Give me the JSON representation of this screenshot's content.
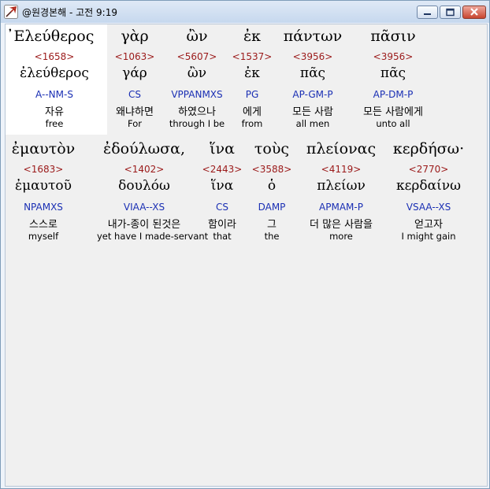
{
  "window": {
    "title": "@원경본해 - 고전 9:19",
    "icon": "cursor-arrow-icon",
    "buttons": [
      "minimize-icon",
      "maximize-icon",
      "close-icon"
    ]
  },
  "verse_lines": [
    {
      "words": [
        {
          "greek": "᾿Ελεύθερος",
          "strong": "<1658>",
          "lemma": "ἐλεύθερος",
          "parse": "A--NM-S",
          "korean": "자유",
          "english": "free",
          "highlighted": true
        },
        {
          "greek": "γὰρ",
          "strong": "<1063>",
          "lemma": "γάρ",
          "parse": "CS",
          "korean": "왜냐하면",
          "english": "For"
        },
        {
          "greek": "ὢν",
          "strong": "<5607>",
          "lemma": "ὢν",
          "parse": "VPPANMXS",
          "korean": "하였으나",
          "english": "through I be"
        },
        {
          "greek": "ἐκ",
          "strong": "<1537>",
          "lemma": "ἐκ",
          "parse": "PG",
          "korean": "에게",
          "english": "from"
        },
        {
          "greek": "πάντων",
          "strong": "<3956>",
          "lemma": "πᾶς",
          "parse": "AP-GM-P",
          "korean": "모든 사람",
          "english": "all men"
        },
        {
          "greek": "πᾶσιν",
          "strong": "<3956>",
          "lemma": "πᾶς",
          "parse": "AP-DM-P",
          "korean": "모든 사람에게",
          "english": "unto all"
        }
      ]
    },
    {
      "words": [
        {
          "greek": "ἐμαυτὸν",
          "strong": "<1683>",
          "lemma": "ἐμαυτοῦ",
          "parse": "NPAMXS",
          "korean": "스스로",
          "english": "myself"
        },
        {
          "greek": "ἐδούλωσα,",
          "strong": "<1402>",
          "lemma": "δουλόω",
          "parse": "VIAA--XS",
          "korean": "내가-종이 된것은",
          "english": "yet have I made-servant"
        },
        {
          "greek": "ἵνα",
          "strong": "<2443>",
          "lemma": "ἵνα",
          "parse": "CS",
          "korean": "함이라",
          "english": "that"
        },
        {
          "greek": "τοὺς",
          "strong": "<3588>",
          "lemma": "ὁ",
          "parse": "DAMP",
          "korean": "그",
          "english": "the"
        },
        {
          "greek": "πλείονας",
          "strong": "<4119>",
          "lemma": "πλείων",
          "parse": "APMAM-P",
          "korean": "더 많은 사람을",
          "english": "more"
        },
        {
          "greek": "κερδήσω·",
          "strong": "<2770>",
          "lemma": "κερδαίνω",
          "parse": "VSAA--XS",
          "korean": "얻고자",
          "english": "I might gain"
        }
      ]
    }
  ],
  "colors": {
    "strong": "#9b1a1a",
    "parse": "#1a2fb4",
    "highlight": "#ffffff",
    "background": "#f0f0f0"
  }
}
